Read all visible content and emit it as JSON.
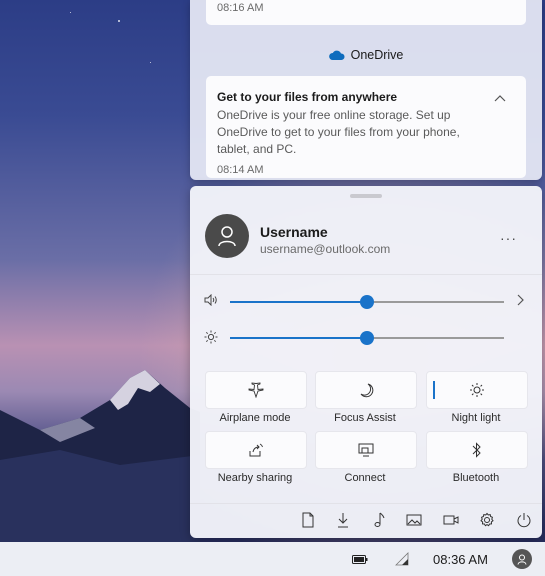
{
  "notifications": {
    "previous_time": "08:16 AM",
    "app_name": "OneDrive",
    "card": {
      "title": "Get to your files from anywhere",
      "body": "OneDrive is your free online storage. Set up OneDrive to get to your files from your phone, tablet, and PC.",
      "time": "08:14 AM"
    }
  },
  "account": {
    "username": "Username",
    "email": "username@outlook.com",
    "more_label": "···"
  },
  "sliders": {
    "volume": {
      "icon": "speaker-icon",
      "value_percent": 50
    },
    "brightness": {
      "icon": "brightness-icon",
      "value_percent": 50
    }
  },
  "tiles": [
    {
      "label": "Airplane mode",
      "icon": "airplane-icon",
      "active": false
    },
    {
      "label": "Focus Assist",
      "icon": "moon-icon",
      "active": false
    },
    {
      "label": "Night light",
      "icon": "sun-icon",
      "active": true
    },
    {
      "label": "Nearby sharing",
      "icon": "share-icon",
      "active": false
    },
    {
      "label": "Connect",
      "icon": "cast-icon",
      "active": false
    },
    {
      "label": "Bluetooth",
      "icon": "bluetooth-icon",
      "active": false
    }
  ],
  "bottom_bar_icons": [
    "document-icon",
    "download-icon",
    "music-icon",
    "image-icon",
    "video-icon",
    "gear-icon",
    "power-icon"
  ],
  "taskbar": {
    "time": "08:36 AM",
    "icons": [
      "battery-icon",
      "wifi-icon",
      "avatar"
    ]
  },
  "colors": {
    "accent": "#1a73c9",
    "onedrive": "#0f6cbd"
  }
}
